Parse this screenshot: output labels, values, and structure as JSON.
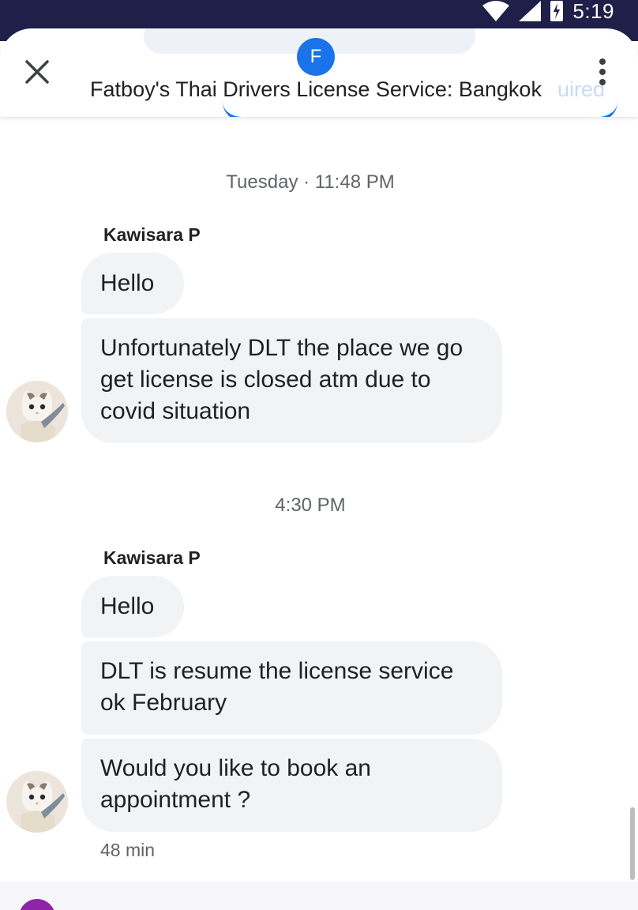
{
  "status_bar": {
    "time": "5:19",
    "icons": [
      "wifi-icon",
      "signal-icon",
      "battery-charging-icon"
    ]
  },
  "header": {
    "avatar_letter": "F",
    "title": "Fatboy's Thai Drivers License Service: Bangkok",
    "ghost_text": "uired",
    "close_icon": "close-icon",
    "more_icon": "more-vert-icon",
    "colors": {
      "avatar": "#1a73e8",
      "accent": "#1a73e8"
    }
  },
  "conversation": {
    "groups": [
      {
        "timestamp": "Tuesday · 11:48 PM",
        "sender": "Kawisara P",
        "messages": [
          "Hello",
          "Unfortunately DLT the place we go get license is closed atm due to covid situation"
        ]
      },
      {
        "timestamp": "4:30 PM",
        "sender": "Kawisara P",
        "messages": [
          "Hello",
          "DLT is resume the license service ok February",
          "Would you like to book an appointment ?"
        ],
        "time_ago": "48 min"
      }
    ]
  },
  "colors": {
    "status_bar": "#1f1f4a",
    "bubble": "#f1f3f4",
    "compose_avatar": "#8e24aa"
  }
}
